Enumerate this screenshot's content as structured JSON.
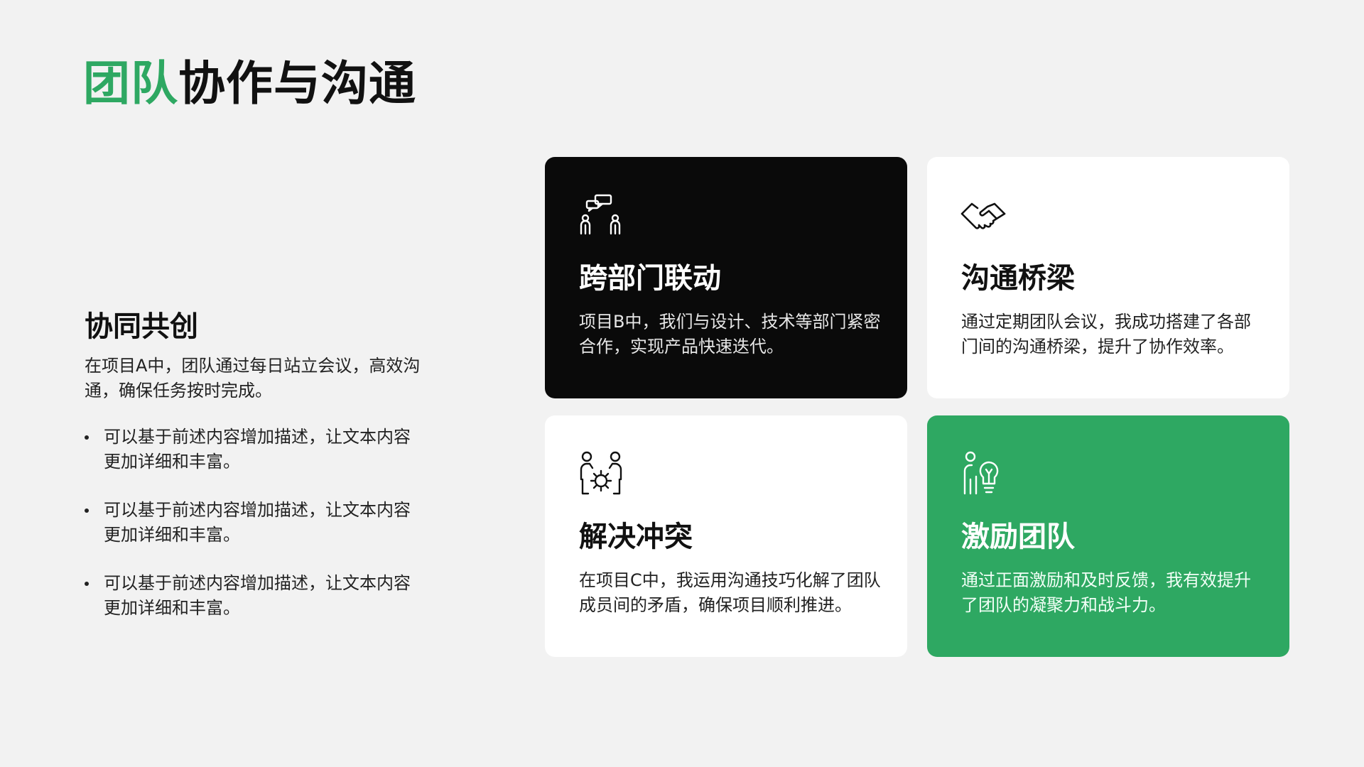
{
  "title": {
    "accent": "团队",
    "rest": "协作与沟通"
  },
  "colors": {
    "accent": "#2ea862",
    "background": "#f2f2f2",
    "dark_card": "#0a0a0a",
    "light_card": "#ffffff"
  },
  "left": {
    "heading": "协同共创",
    "description": "在项目A中，团队通过每日站立会议，高效沟通，确保任务按时完成。",
    "bullets": [
      "可以基于前述内容增加描述，让文本内容更加详细和丰富。",
      "可以基于前述内容增加描述，让文本内容更加详细和丰富。",
      "可以基于前述内容增加描述，让文本内容更加详细和丰富。"
    ]
  },
  "cards": [
    {
      "icon": "team-discussion-icon",
      "title": "跨部门联动",
      "description": "项目B中，我们与设计、技术等部门紧密合作，实现产品快速迭代。"
    },
    {
      "icon": "handshake-icon",
      "title": "沟通桥梁",
      "description": "通过定期团队会议，我成功搭建了各部门间的沟通桥梁，提升了协作效率。"
    },
    {
      "icon": "team-gear-icon",
      "title": "解决冲突",
      "description": "在项目C中，我运用沟通技巧化解了团队成员间的矛盾，确保项目顺利推进。"
    },
    {
      "icon": "idea-person-icon",
      "title": "激励团队",
      "description": "通过正面激励和及时反馈，我有效提升了团队的凝聚力和战斗力。"
    }
  ]
}
